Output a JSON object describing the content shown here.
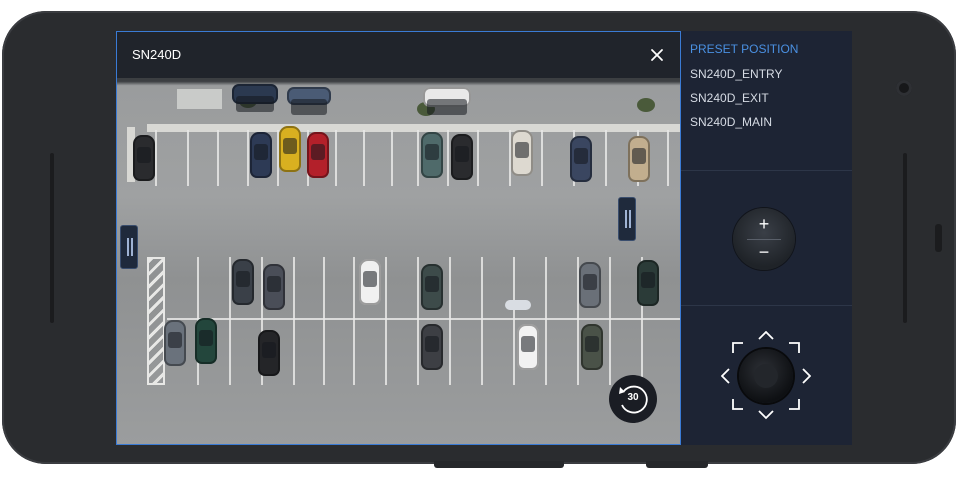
{
  "video": {
    "title": "SN240D",
    "close_icon": "close-icon",
    "rewind_label": "30"
  },
  "presets": {
    "header": "PRESET POSITION",
    "items": [
      "SN240D_ENTRY",
      "SN240D_EXIT",
      "SN240D_MAIN"
    ]
  },
  "zoom": {
    "plus_label": "+",
    "minus_label": "−"
  },
  "joystick": {
    "up": "︿",
    "down": "﹀",
    "left": "‹",
    "right": "›"
  },
  "colors": {
    "accent": "#4a90e2",
    "panel": "#1d2434",
    "phone": "#2a2c2f"
  }
}
